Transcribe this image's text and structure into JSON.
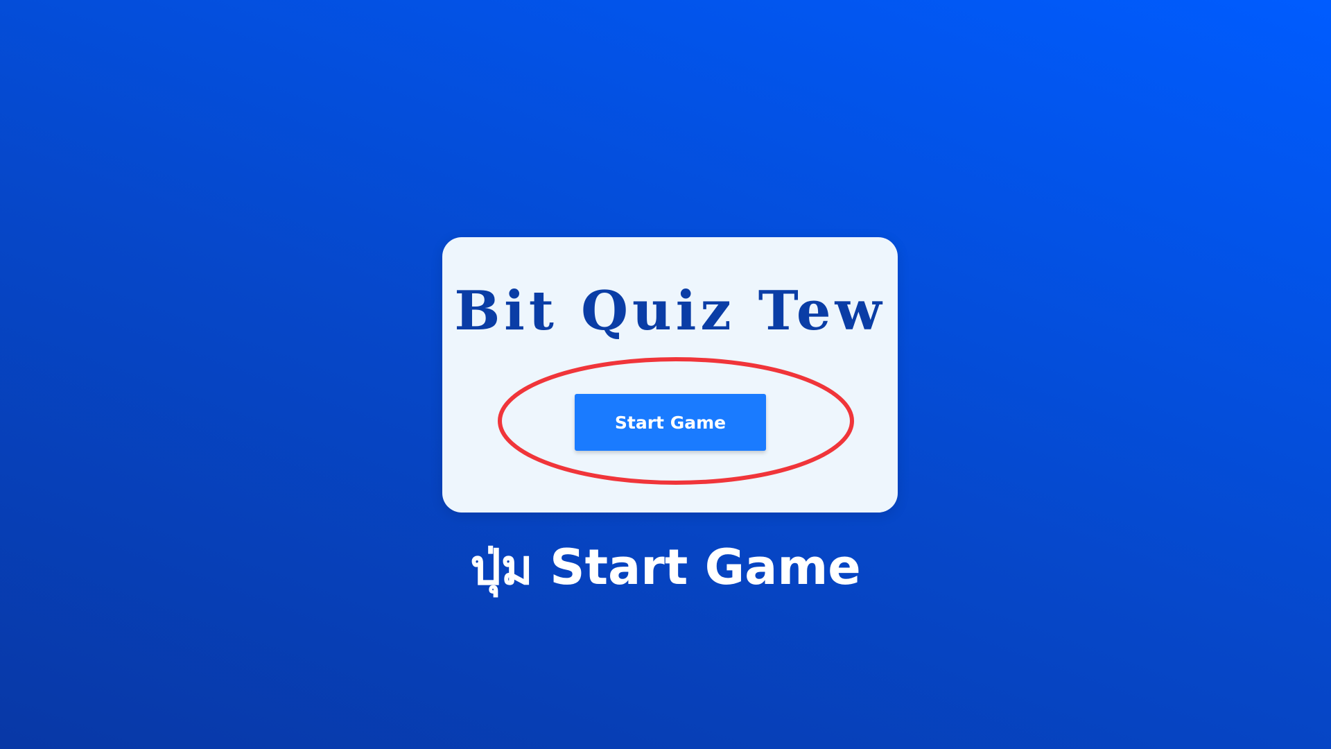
{
  "app": {
    "title": "Bit Quiz Tew"
  },
  "start_button": {
    "label": "Start Game"
  },
  "caption": {
    "text": "ปุ่ม Start Game"
  },
  "colors": {
    "background_start": "#0838a6",
    "background_end": "#005cff",
    "card_background": "#eef6fd",
    "title_color": "#0a3da6",
    "button_color": "#1a7bff",
    "highlight_color": "#f0353a"
  }
}
